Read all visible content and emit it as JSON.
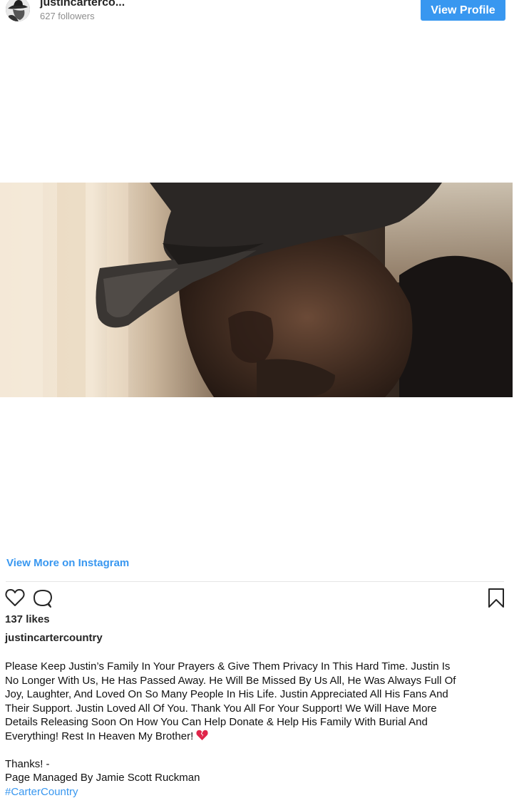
{
  "header": {
    "username": "justincarterco...",
    "followers": "627 followers",
    "view_profile_label": "View Profile"
  },
  "media": {
    "description_icon": "photo-man-in-cowboy-hat"
  },
  "footer": {
    "view_more_label": "View More on Instagram",
    "likes": "137 likes",
    "author": "justincartercountry",
    "caption_lines": [
      "Please Keep Justin’s Family In Your Prayers & Give Them Privacy In This Hard Time. Justin Is",
      "No Longer With Us, He Has Passed Away. He Will Be Missed By Us All, He Was Always Full Of",
      "Joy, Laughter, And Loved On So Many People In His Life. Justin Appreciated All His Fans And",
      "Their Support. Justin Loved All Of You. Thank You All For Your Support! We Will Have More",
      "Details Releasing Soon On How You Can Help Donate & Help His Family With Burial And",
      "Everything! Rest In Heaven My Brother!"
    ],
    "thanks": "Thanks! -",
    "managed_by": "Page Managed By Jamie Scott Ruckman",
    "hashtag": "#CarterCountry"
  },
  "icons": {
    "heart": "heart-icon",
    "comment": "comment-icon",
    "bookmark": "bookmark-icon",
    "broken_heart": "broken-heart-icon"
  },
  "colors": {
    "accent": "#3897f0",
    "text": "#262626",
    "muted": "#8e8e8e",
    "divider": "#e6e6e6"
  }
}
